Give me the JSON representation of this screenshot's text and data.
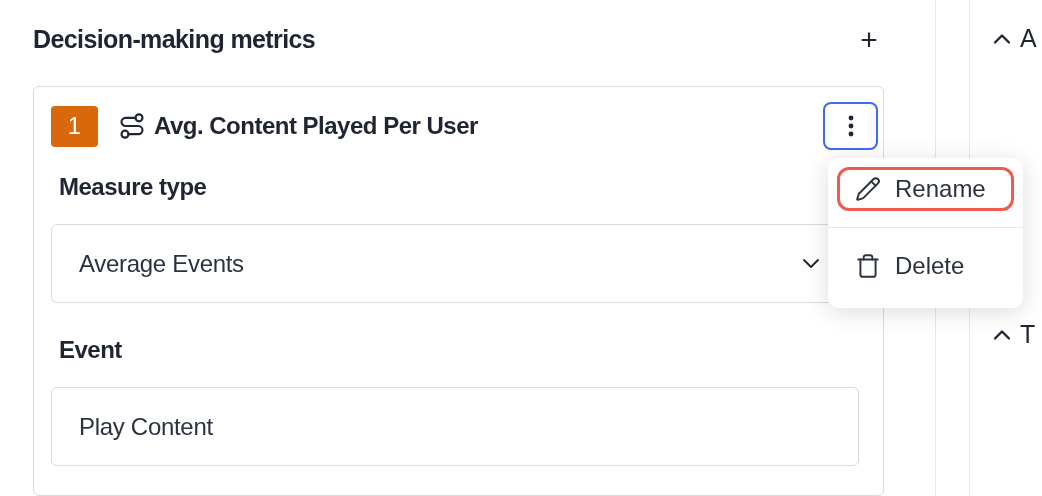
{
  "section": {
    "title": "Decision-making metrics",
    "add_label": "+"
  },
  "metric": {
    "number": "1",
    "name": "Avg. Content Played Per User",
    "menu_open": true,
    "fields": [
      {
        "label": "Measure type",
        "value": "Average Events",
        "kind": "select"
      },
      {
        "label": "Event",
        "value": "Play Content",
        "kind": "text"
      }
    ]
  },
  "menu": [
    {
      "label": "Rename",
      "kind": "pencil",
      "selected": true
    },
    {
      "label": "Delete",
      "kind": "trash",
      "selected": false
    }
  ],
  "side_sections": [
    {
      "title": "A",
      "expanded": true
    },
    {
      "title": "T",
      "expanded": true
    }
  ]
}
